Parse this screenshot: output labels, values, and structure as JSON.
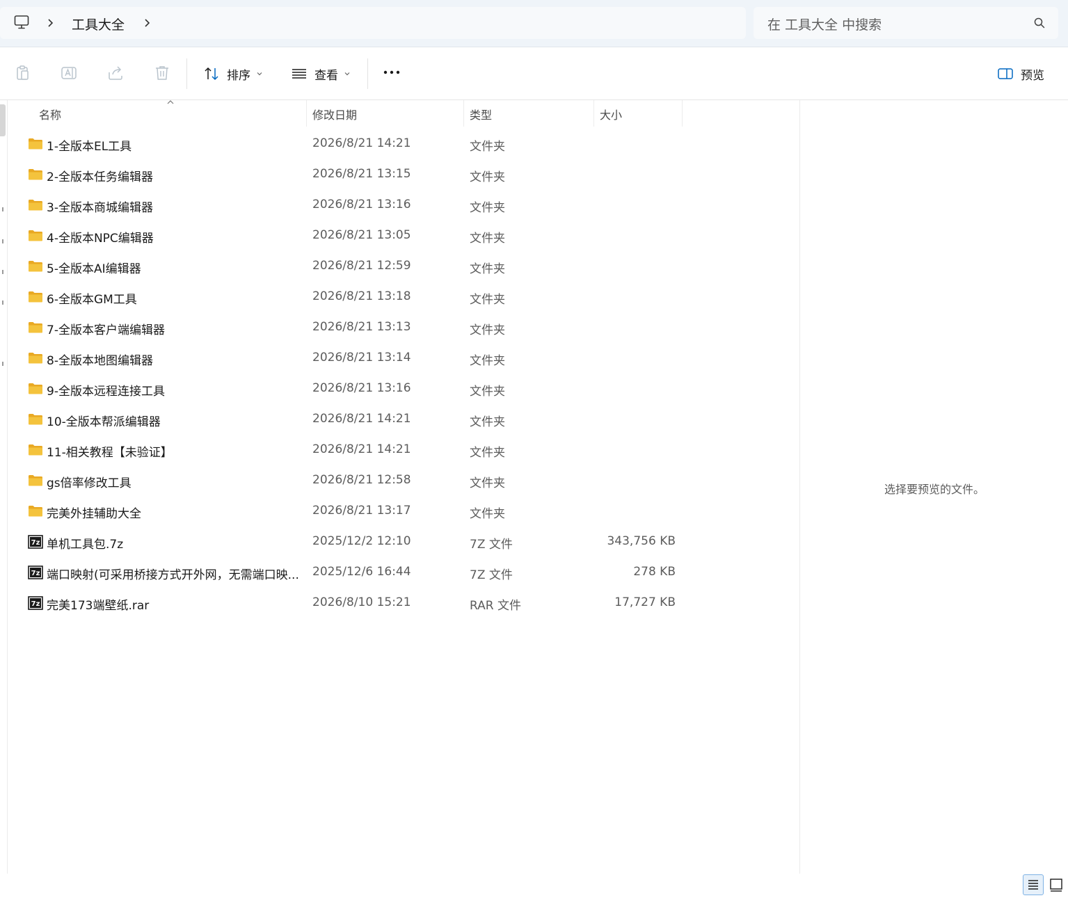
{
  "address_bar": {
    "breadcrumb": [
      "工具大全"
    ],
    "search_placeholder": "在 工具大全 中搜索"
  },
  "toolbar": {
    "sort_label": "排序",
    "view_label": "查看",
    "preview_label": "预览"
  },
  "columns": {
    "name": "名称",
    "modified": "修改日期",
    "type": "类型",
    "size": "大小"
  },
  "files": [
    {
      "name": "1-全版本EL工具",
      "modified": "2026/8/21 14:21",
      "type": "文件夹",
      "size": "",
      "kind": "folder"
    },
    {
      "name": "2-全版本任务编辑器",
      "modified": "2026/8/21 13:15",
      "type": "文件夹",
      "size": "",
      "kind": "folder"
    },
    {
      "name": "3-全版本商城编辑器",
      "modified": "2026/8/21 13:16",
      "type": "文件夹",
      "size": "",
      "kind": "folder"
    },
    {
      "name": "4-全版本NPC编辑器",
      "modified": "2026/8/21 13:05",
      "type": "文件夹",
      "size": "",
      "kind": "folder"
    },
    {
      "name": "5-全版本AI编辑器",
      "modified": "2026/8/21 12:59",
      "type": "文件夹",
      "size": "",
      "kind": "folder"
    },
    {
      "name": "6-全版本GM工具",
      "modified": "2026/8/21 13:18",
      "type": "文件夹",
      "size": "",
      "kind": "folder"
    },
    {
      "name": "7-全版本客户端编辑器",
      "modified": "2026/8/21 13:13",
      "type": "文件夹",
      "size": "",
      "kind": "folder"
    },
    {
      "name": "8-全版本地图编辑器",
      "modified": "2026/8/21 13:14",
      "type": "文件夹",
      "size": "",
      "kind": "folder"
    },
    {
      "name": "9-全版本远程连接工具",
      "modified": "2026/8/21 13:16",
      "type": "文件夹",
      "size": "",
      "kind": "folder"
    },
    {
      "name": "10-全版本帮派编辑器",
      "modified": "2026/8/21 14:21",
      "type": "文件夹",
      "size": "",
      "kind": "folder"
    },
    {
      "name": "11-相关教程【未验证】",
      "modified": "2026/8/21 14:21",
      "type": "文件夹",
      "size": "",
      "kind": "folder"
    },
    {
      "name": "gs倍率修改工具",
      "modified": "2026/8/21 12:58",
      "type": "文件夹",
      "size": "",
      "kind": "folder"
    },
    {
      "name": "完美外挂辅助大全",
      "modified": "2026/8/21 13:17",
      "type": "文件夹",
      "size": "",
      "kind": "folder"
    },
    {
      "name": "单机工具包.7z",
      "modified": "2025/12/2 12:10",
      "type": "7Z 文件",
      "size": "343,756 KB",
      "kind": "archive"
    },
    {
      "name": "端口映射(可采用桥接方式开外网，无需端口映...",
      "modified": "2025/12/6 16:44",
      "type": "7Z 文件",
      "size": "278 KB",
      "kind": "archive"
    },
    {
      "name": "完美173端壁纸.rar",
      "modified": "2026/8/10 15:21",
      "type": "RAR 文件",
      "size": "17,727 KB",
      "kind": "archive"
    }
  ],
  "preview_pane": {
    "message": "选择要预览的文件。"
  },
  "colors": {
    "address_bg": "#eff4f9",
    "folder": "#f4c33d",
    "accent": "#0067c0"
  }
}
